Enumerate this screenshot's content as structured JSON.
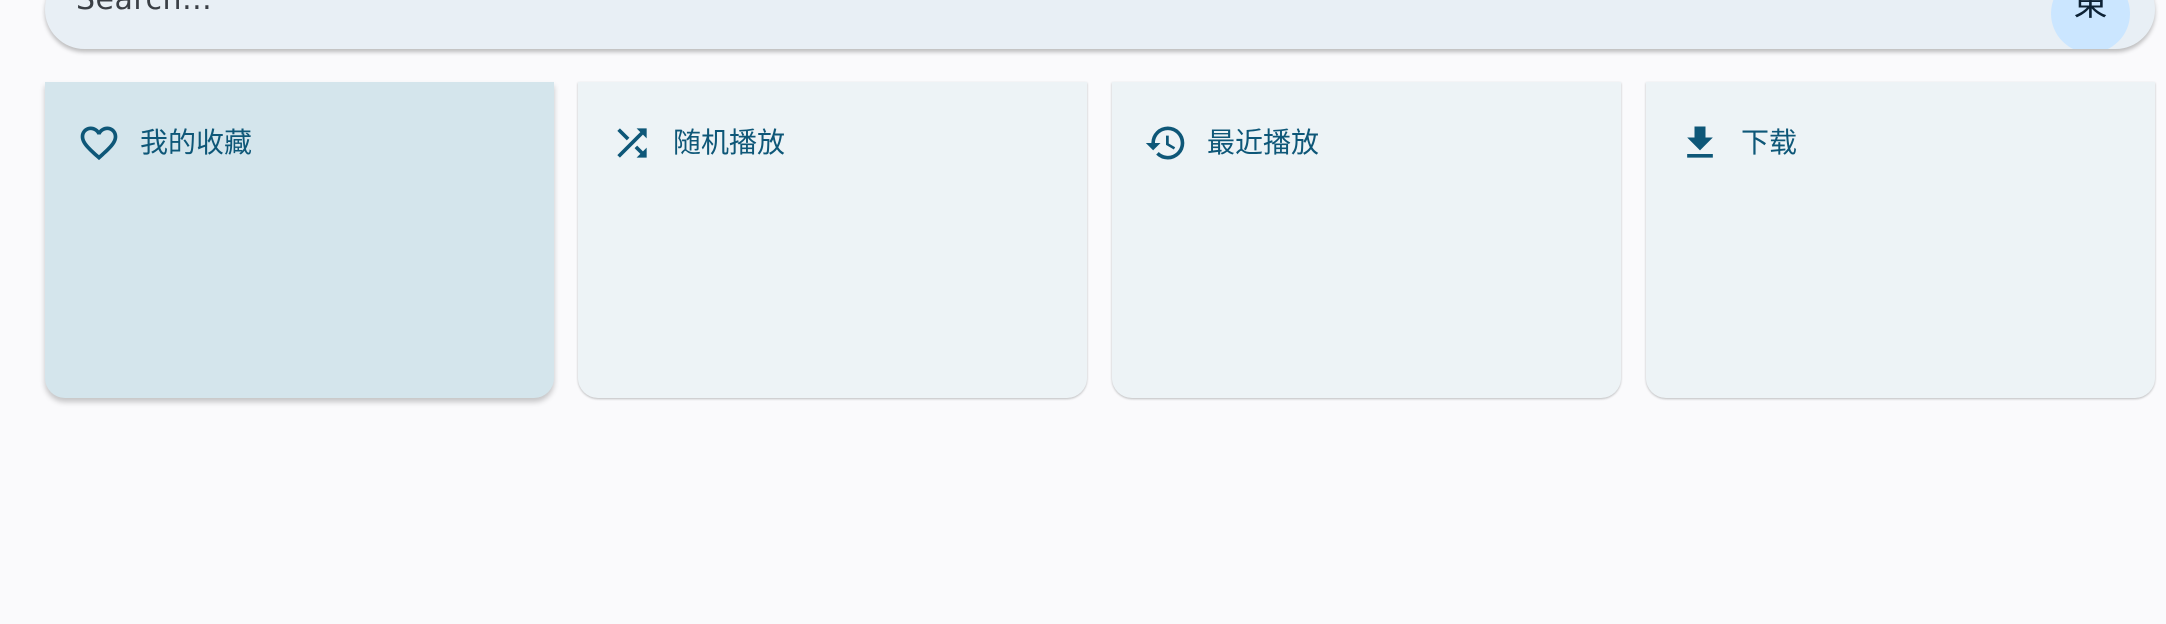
{
  "search": {
    "placeholder": "Search...",
    "avatar_letter": "東"
  },
  "cards": [
    {
      "label": "我的收藏",
      "icon": "heart-outline-icon"
    },
    {
      "label": "随机播放",
      "icon": "shuffle-icon"
    },
    {
      "label": "最近播放",
      "icon": "history-icon"
    },
    {
      "label": "下载",
      "icon": "download-icon"
    }
  ],
  "colors": {
    "accent": "#0e5778",
    "card_bg": "#edf3f6",
    "card_active_bg": "#d4e5ec",
    "search_bg": "#e8eff5",
    "avatar_bg": "#cbe6ff"
  }
}
